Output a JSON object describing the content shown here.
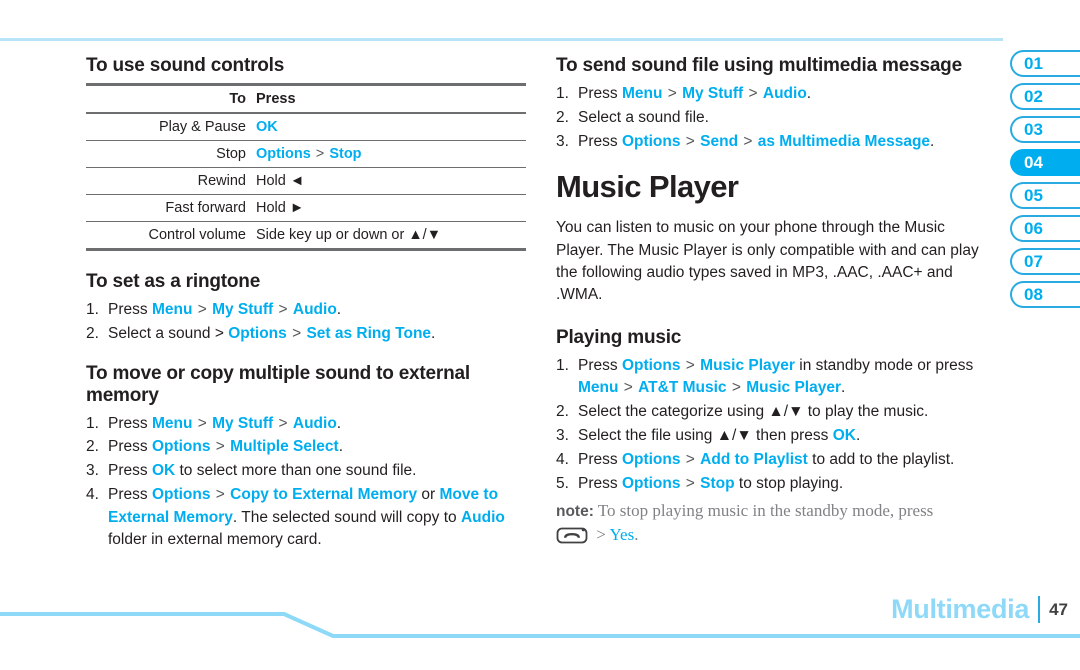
{
  "page": {
    "footer_section": "Multimedia",
    "footer_page": "47",
    "accent_blue": "#00aeef",
    "rule_blue": "#8ed8f8"
  },
  "tabs": [
    {
      "label": "01",
      "active": false
    },
    {
      "label": "02",
      "active": false
    },
    {
      "label": "03",
      "active": false
    },
    {
      "label": "04",
      "active": true
    },
    {
      "label": "05",
      "active": false
    },
    {
      "label": "06",
      "active": false
    },
    {
      "label": "07",
      "active": false
    },
    {
      "label": "08",
      "active": false
    }
  ],
  "left": {
    "sound_controls": {
      "heading": "To use sound controls",
      "columns": [
        "To",
        "Press"
      ],
      "rows": [
        {
          "to": "Play & Pause",
          "press_parts": [
            {
              "t": "OK",
              "k": true
            }
          ]
        },
        {
          "to": "Stop",
          "press_parts": [
            {
              "t": "Options",
              "k": true
            },
            {
              "t": " > ",
              "k": false
            },
            {
              "t": "Stop",
              "k": true
            }
          ]
        },
        {
          "to": "Rewind",
          "press_parts": [
            {
              "t": "Hold ◄",
              "k": false
            }
          ]
        },
        {
          "to": "Fast forward",
          "press_parts": [
            {
              "t": "Hold ►",
              "k": false
            }
          ]
        },
        {
          "to": "Control volume",
          "press_parts": [
            {
              "t": "Side key up or down or ▲/▼",
              "k": false
            }
          ]
        }
      ]
    },
    "ringtone": {
      "heading": "To set as a ringtone",
      "steps": [
        {
          "num": "1.",
          "parts": [
            {
              "t": "Press ",
              "k": false
            },
            {
              "t": "Menu",
              "k": true
            },
            {
              "t": " > ",
              "k": false
            },
            {
              "t": "My Stuff",
              "k": true
            },
            {
              "t": " > ",
              "k": false
            },
            {
              "t": "Audio",
              "k": true
            },
            {
              "t": ".",
              "k": false
            }
          ]
        },
        {
          "num": "2.",
          "parts": [
            {
              "t": "Select a sound > ",
              "k": false
            },
            {
              "t": "Options",
              "k": true
            },
            {
              "t": " > ",
              "k": false
            },
            {
              "t": "Set as Ring Tone",
              "k": true
            },
            {
              "t": ".",
              "k": false
            }
          ]
        }
      ]
    },
    "move_copy": {
      "heading": "To move or copy multiple sound to external memory",
      "steps": [
        {
          "num": "1.",
          "parts": [
            {
              "t": "Press ",
              "k": false
            },
            {
              "t": "Menu",
              "k": true
            },
            {
              "t": " > ",
              "k": false
            },
            {
              "t": "My Stuff",
              "k": true
            },
            {
              "t": " > ",
              "k": false
            },
            {
              "t": "Audio",
              "k": true
            },
            {
              "t": ".",
              "k": false
            }
          ]
        },
        {
          "num": "2.",
          "parts": [
            {
              "t": "Press ",
              "k": false
            },
            {
              "t": "Options",
              "k": true
            },
            {
              "t": " > ",
              "k": false
            },
            {
              "t": "Multiple Select",
              "k": true
            },
            {
              "t": ".",
              "k": false
            }
          ]
        },
        {
          "num": "3.",
          "parts": [
            {
              "t": "Press ",
              "k": false
            },
            {
              "t": "OK",
              "k": true
            },
            {
              "t": " to select more than one sound file.",
              "k": false
            }
          ]
        },
        {
          "num": "4.",
          "parts": [
            {
              "t": "Press ",
              "k": false
            },
            {
              "t": "Options",
              "k": true
            },
            {
              "t": " > ",
              "k": false
            },
            {
              "t": "Copy to External Memory",
              "k": true
            },
            {
              "t": " or ",
              "k": false
            },
            {
              "t": "Move to External Memory",
              "k": true
            },
            {
              "t": ". The selected sound will copy to ",
              "k": false
            },
            {
              "t": "Audio",
              "k": true
            },
            {
              "t": " folder in external memory card.",
              "k": false
            }
          ]
        }
      ]
    }
  },
  "right": {
    "send_mms": {
      "heading": "To send sound file using multimedia message",
      "steps": [
        {
          "num": "1.",
          "parts": [
            {
              "t": "Press ",
              "k": false
            },
            {
              "t": "Menu",
              "k": true
            },
            {
              "t": " > ",
              "k": false
            },
            {
              "t": "My Stuff",
              "k": true
            },
            {
              "t": " > ",
              "k": false
            },
            {
              "t": "Audio",
              "k": true
            },
            {
              "t": ".",
              "k": false
            }
          ]
        },
        {
          "num": "2.",
          "parts": [
            {
              "t": "Select a sound file.",
              "k": false
            }
          ]
        },
        {
          "num": "3.",
          "parts": [
            {
              "t": "Press ",
              "k": false
            },
            {
              "t": "Options",
              "k": true
            },
            {
              "t": " > ",
              "k": false
            },
            {
              "t": "Send",
              "k": true
            },
            {
              "t": " > ",
              "k": false
            },
            {
              "t": "as Multimedia Message",
              "k": true
            },
            {
              "t": ".",
              "k": false
            }
          ]
        }
      ]
    },
    "music_player": {
      "title": "Music Player",
      "intro": "You can listen to music on your phone through the Music Player. The Music Player is only compatible with and can play the following audio types saved in MP3, .AAC, .AAC+ and .WMA."
    },
    "playing_music": {
      "heading": "Playing music",
      "steps": [
        {
          "num": "1.",
          "parts": [
            {
              "t": "Press ",
              "k": false
            },
            {
              "t": "Options",
              "k": true
            },
            {
              "t": " > ",
              "k": false
            },
            {
              "t": "Music Player",
              "k": true
            },
            {
              "t": " in standby mode or press ",
              "k": false
            },
            {
              "t": "Menu",
              "k": true
            },
            {
              "t": " > ",
              "k": false
            },
            {
              "t": "AT&T Music",
              "k": true
            },
            {
              "t": " > ",
              "k": false
            },
            {
              "t": "Music Player",
              "k": true
            },
            {
              "t": ".",
              "k": false
            }
          ]
        },
        {
          "num": "2.",
          "parts": [
            {
              "t": "Select the categorize using ▲/▼ to play the music.",
              "k": false
            }
          ]
        },
        {
          "num": "3.",
          "parts": [
            {
              "t": "Select the file using ▲/▼ then press ",
              "k": false
            },
            {
              "t": "OK",
              "k": true
            },
            {
              "t": ".",
              "k": false
            }
          ]
        },
        {
          "num": "4.",
          "parts": [
            {
              "t": "Press ",
              "k": false
            },
            {
              "t": "Options",
              "k": true
            },
            {
              "t": " > ",
              "k": false
            },
            {
              "t": "Add to Playlist",
              "k": true
            },
            {
              "t": " to add to the playlist.",
              "k": false
            }
          ]
        },
        {
          "num": "5.",
          "parts": [
            {
              "t": "Press ",
              "k": false
            },
            {
              "t": "Options",
              "k": true
            },
            {
              "t": " > ",
              "k": false
            },
            {
              "t": "Stop",
              "k": true
            },
            {
              "t": " to stop playing.",
              "k": false
            }
          ]
        }
      ]
    },
    "note": {
      "label": "note:",
      "text_before_icon": " To stop playing music in the standby mode, press ",
      "icon": "end-call-key-icon",
      "text_after_icon": " > ",
      "link": "Yes",
      "tail": "."
    }
  }
}
